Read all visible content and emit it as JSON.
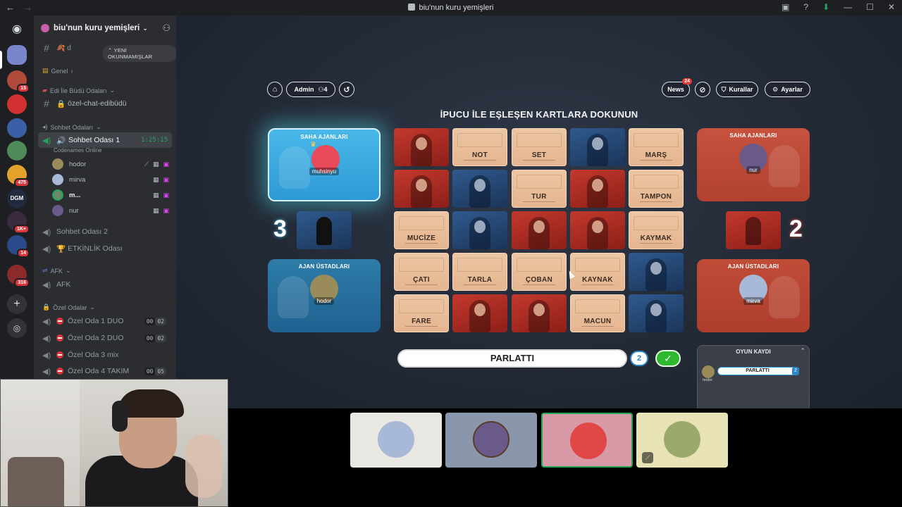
{
  "titlebar": {
    "title": "biu'nun kuru yemişleri"
  },
  "rail": {
    "badges": [
      "15",
      "475",
      "1K+",
      "14",
      "316"
    ],
    "dgm_label": "DGM"
  },
  "sidebar": {
    "server_name": "biu'nun kuru yemişleri",
    "unread_pill": "YENİ OKUNMAMIŞLAR",
    "genel": "Genel",
    "category_edi": "Edi İle Büdü Odaları",
    "channel_private": "özel-chat-edibüdü",
    "category_sohbet": "Sohbet Odaları",
    "voice_active": {
      "name": "Sohbet Odası 1",
      "time": "1:25:15",
      "activity": "Codenames Online"
    },
    "members": [
      "hodor",
      "mirva",
      "m...",
      "nur"
    ],
    "voice_2": "Sohbet Odası 2",
    "voice_event": "ETKİNLİK Odası",
    "category_afk": "AFK",
    "voice_afk": "AFK",
    "category_ozel": "Özel Odalar",
    "rooms": [
      {
        "name": "Özel Oda 1 DUO",
        "a": "00",
        "b": "02"
      },
      {
        "name": "Özel Oda 2 DUO",
        "a": "00",
        "b": "02"
      },
      {
        "name": "Özel Oda 3 mix",
        "a": "",
        "b": ""
      },
      {
        "name": "Özel Oda 4 TAKIM",
        "a": "00",
        "b": "05"
      }
    ]
  },
  "game": {
    "admin_label": "Admin",
    "player_count": "4",
    "news_label": "News",
    "news_badge": "24",
    "rules_label": "Kurallar",
    "settings_label": "Ayarlar",
    "prompt": "İPUCU İLE EŞLEŞEN KARTLARA DOKUNUN",
    "blue": {
      "operatives_label": "SAHA AJANLARI",
      "operative": "muhsinyu",
      "score": "3",
      "spymasters_label": "AJAN ÜSTADLARI",
      "spymaster": "hodor"
    },
    "red": {
      "operatives_label": "SAHA AJANLARI",
      "operative": "nur",
      "score": "2",
      "spymasters_label": "AJAN ÜSTADLARI",
      "spymaster": "mirva"
    },
    "words": [
      "NOT",
      "SET",
      "MARŞ",
      "TUR",
      "TAMPON",
      "MUCİZE",
      "KAYMAK",
      "ÇATI",
      "TARLA",
      "ÇOBAN",
      "KAYNAK",
      "FARE",
      "MACUN"
    ],
    "clue": {
      "word": "PARLATTI",
      "number": "2",
      "confirm": "✓"
    },
    "log": {
      "title": "OYUN KAYDI",
      "entry_word": "PARLATTI",
      "entry_number": "2",
      "entry_player": "hodor"
    }
  },
  "colors": {
    "discord_bg": "#1e1f22",
    "sidebar_bg": "#2b2d31",
    "online_green": "#23a55a",
    "blue_team": "#2e9ad6",
    "red_team": "#c04c38",
    "card_beige": "#e5b590"
  }
}
